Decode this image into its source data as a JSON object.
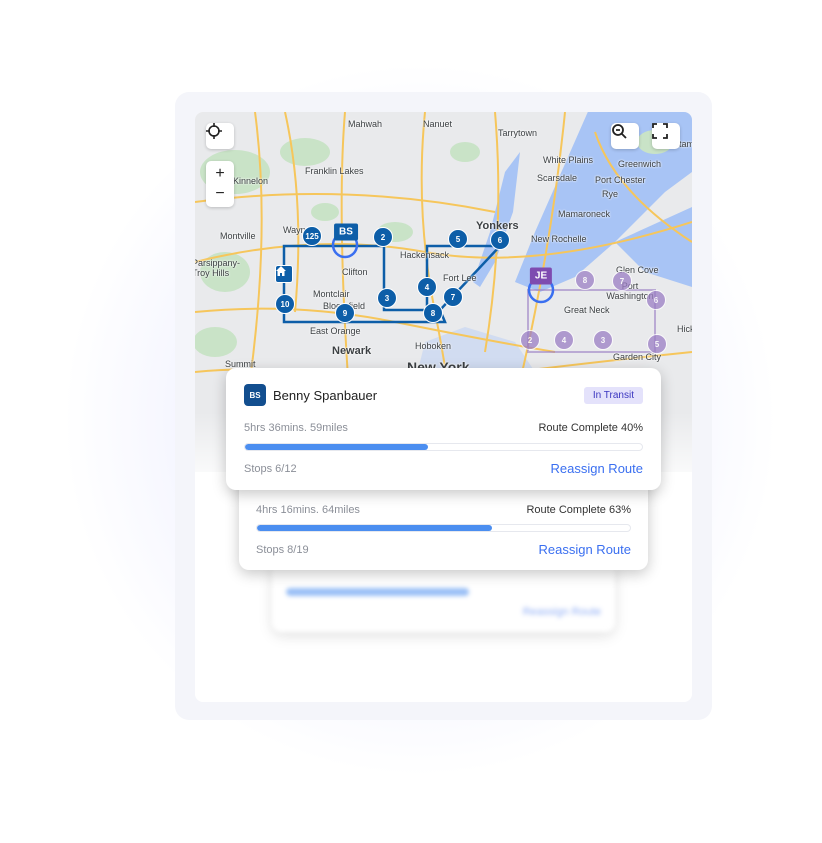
{
  "colors": {
    "route": "#0d5ea8",
    "secondary_route": "#9b7ec4",
    "accent": "#3a6ff0",
    "progress": "#4b8ef0",
    "badge_bg": "#e4e2fb",
    "badge_text": "#3b36c0"
  },
  "map": {
    "controls": {
      "locate_icon": "crosshair-icon",
      "zoom_in": "+",
      "zoom_out": "−",
      "search_icon": "zoom-search-icon",
      "fullscreen_icon": "fullscreen-icon"
    },
    "places": [
      "Mahwah",
      "Nanuet",
      "Franklin Lakes",
      "Kinnelon",
      "Wayne",
      "Montville",
      "Parsippany-Troy Hills",
      "Clifton",
      "Montclair",
      "Bloomfield",
      "East Orange",
      "Newark",
      "Hoboken",
      "Hackensack",
      "New York",
      "Fort Lee",
      "Yonkers",
      "Tarrytown",
      "White Plains",
      "Scarsdale",
      "Greenwich",
      "Port Chester",
      "Rye",
      "Mamaroneck",
      "New Rochelle",
      "Glen Cove",
      "Port Washington",
      "Great Neck",
      "Garden City",
      "Hick",
      "Summit",
      "Stamford"
    ],
    "driver_tags": [
      "BS",
      "JE"
    ],
    "route_stops": [
      "125",
      "2",
      "3",
      "4",
      "5",
      "6",
      "7",
      "8",
      "9",
      "10"
    ],
    "secondary_stops": [
      "8",
      "7",
      "6",
      "5",
      "3",
      "2",
      "4"
    ]
  },
  "cards": [
    {
      "initials": "BS",
      "name": "Benny Spanbauer",
      "status": "In Transit",
      "duration": "5hrs 36mins.  59miles",
      "complete": "Route Complete 40%",
      "progress": 40,
      "stops": "Stops  6/12",
      "action": "Reassign Route"
    },
    {
      "duration": "4hrs 16mins.  64miles",
      "complete": "Route Complete 63%",
      "progress": 63,
      "stops": "Stops  8/19",
      "action": "Reassign Route"
    },
    {
      "progress": 58,
      "action": "Reassign Route"
    }
  ]
}
